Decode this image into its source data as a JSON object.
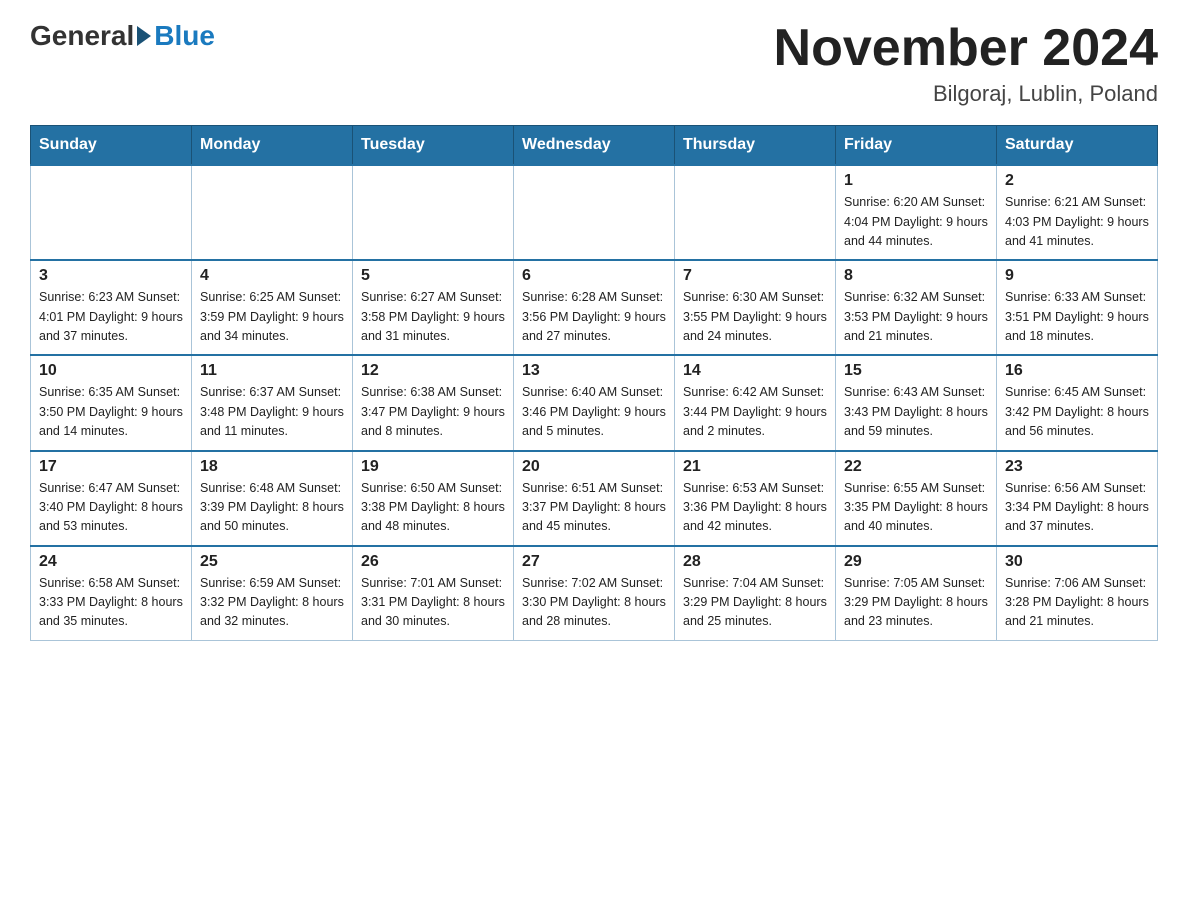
{
  "header": {
    "logo_general": "General",
    "logo_blue": "Blue",
    "month_title": "November 2024",
    "location": "Bilgoraj, Lublin, Poland"
  },
  "days_of_week": [
    "Sunday",
    "Monday",
    "Tuesday",
    "Wednesday",
    "Thursday",
    "Friday",
    "Saturday"
  ],
  "weeks": [
    [
      {
        "day": "",
        "info": ""
      },
      {
        "day": "",
        "info": ""
      },
      {
        "day": "",
        "info": ""
      },
      {
        "day": "",
        "info": ""
      },
      {
        "day": "",
        "info": ""
      },
      {
        "day": "1",
        "info": "Sunrise: 6:20 AM\nSunset: 4:04 PM\nDaylight: 9 hours\nand 44 minutes."
      },
      {
        "day": "2",
        "info": "Sunrise: 6:21 AM\nSunset: 4:03 PM\nDaylight: 9 hours\nand 41 minutes."
      }
    ],
    [
      {
        "day": "3",
        "info": "Sunrise: 6:23 AM\nSunset: 4:01 PM\nDaylight: 9 hours\nand 37 minutes."
      },
      {
        "day": "4",
        "info": "Sunrise: 6:25 AM\nSunset: 3:59 PM\nDaylight: 9 hours\nand 34 minutes."
      },
      {
        "day": "5",
        "info": "Sunrise: 6:27 AM\nSunset: 3:58 PM\nDaylight: 9 hours\nand 31 minutes."
      },
      {
        "day": "6",
        "info": "Sunrise: 6:28 AM\nSunset: 3:56 PM\nDaylight: 9 hours\nand 27 minutes."
      },
      {
        "day": "7",
        "info": "Sunrise: 6:30 AM\nSunset: 3:55 PM\nDaylight: 9 hours\nand 24 minutes."
      },
      {
        "day": "8",
        "info": "Sunrise: 6:32 AM\nSunset: 3:53 PM\nDaylight: 9 hours\nand 21 minutes."
      },
      {
        "day": "9",
        "info": "Sunrise: 6:33 AM\nSunset: 3:51 PM\nDaylight: 9 hours\nand 18 minutes."
      }
    ],
    [
      {
        "day": "10",
        "info": "Sunrise: 6:35 AM\nSunset: 3:50 PM\nDaylight: 9 hours\nand 14 minutes."
      },
      {
        "day": "11",
        "info": "Sunrise: 6:37 AM\nSunset: 3:48 PM\nDaylight: 9 hours\nand 11 minutes."
      },
      {
        "day": "12",
        "info": "Sunrise: 6:38 AM\nSunset: 3:47 PM\nDaylight: 9 hours\nand 8 minutes."
      },
      {
        "day": "13",
        "info": "Sunrise: 6:40 AM\nSunset: 3:46 PM\nDaylight: 9 hours\nand 5 minutes."
      },
      {
        "day": "14",
        "info": "Sunrise: 6:42 AM\nSunset: 3:44 PM\nDaylight: 9 hours\nand 2 minutes."
      },
      {
        "day": "15",
        "info": "Sunrise: 6:43 AM\nSunset: 3:43 PM\nDaylight: 8 hours\nand 59 minutes."
      },
      {
        "day": "16",
        "info": "Sunrise: 6:45 AM\nSunset: 3:42 PM\nDaylight: 8 hours\nand 56 minutes."
      }
    ],
    [
      {
        "day": "17",
        "info": "Sunrise: 6:47 AM\nSunset: 3:40 PM\nDaylight: 8 hours\nand 53 minutes."
      },
      {
        "day": "18",
        "info": "Sunrise: 6:48 AM\nSunset: 3:39 PM\nDaylight: 8 hours\nand 50 minutes."
      },
      {
        "day": "19",
        "info": "Sunrise: 6:50 AM\nSunset: 3:38 PM\nDaylight: 8 hours\nand 48 minutes."
      },
      {
        "day": "20",
        "info": "Sunrise: 6:51 AM\nSunset: 3:37 PM\nDaylight: 8 hours\nand 45 minutes."
      },
      {
        "day": "21",
        "info": "Sunrise: 6:53 AM\nSunset: 3:36 PM\nDaylight: 8 hours\nand 42 minutes."
      },
      {
        "day": "22",
        "info": "Sunrise: 6:55 AM\nSunset: 3:35 PM\nDaylight: 8 hours\nand 40 minutes."
      },
      {
        "day": "23",
        "info": "Sunrise: 6:56 AM\nSunset: 3:34 PM\nDaylight: 8 hours\nand 37 minutes."
      }
    ],
    [
      {
        "day": "24",
        "info": "Sunrise: 6:58 AM\nSunset: 3:33 PM\nDaylight: 8 hours\nand 35 minutes."
      },
      {
        "day": "25",
        "info": "Sunrise: 6:59 AM\nSunset: 3:32 PM\nDaylight: 8 hours\nand 32 minutes."
      },
      {
        "day": "26",
        "info": "Sunrise: 7:01 AM\nSunset: 3:31 PM\nDaylight: 8 hours\nand 30 minutes."
      },
      {
        "day": "27",
        "info": "Sunrise: 7:02 AM\nSunset: 3:30 PM\nDaylight: 8 hours\nand 28 minutes."
      },
      {
        "day": "28",
        "info": "Sunrise: 7:04 AM\nSunset: 3:29 PM\nDaylight: 8 hours\nand 25 minutes."
      },
      {
        "day": "29",
        "info": "Sunrise: 7:05 AM\nSunset: 3:29 PM\nDaylight: 8 hours\nand 23 minutes."
      },
      {
        "day": "30",
        "info": "Sunrise: 7:06 AM\nSunset: 3:28 PM\nDaylight: 8 hours\nand 21 minutes."
      }
    ]
  ]
}
